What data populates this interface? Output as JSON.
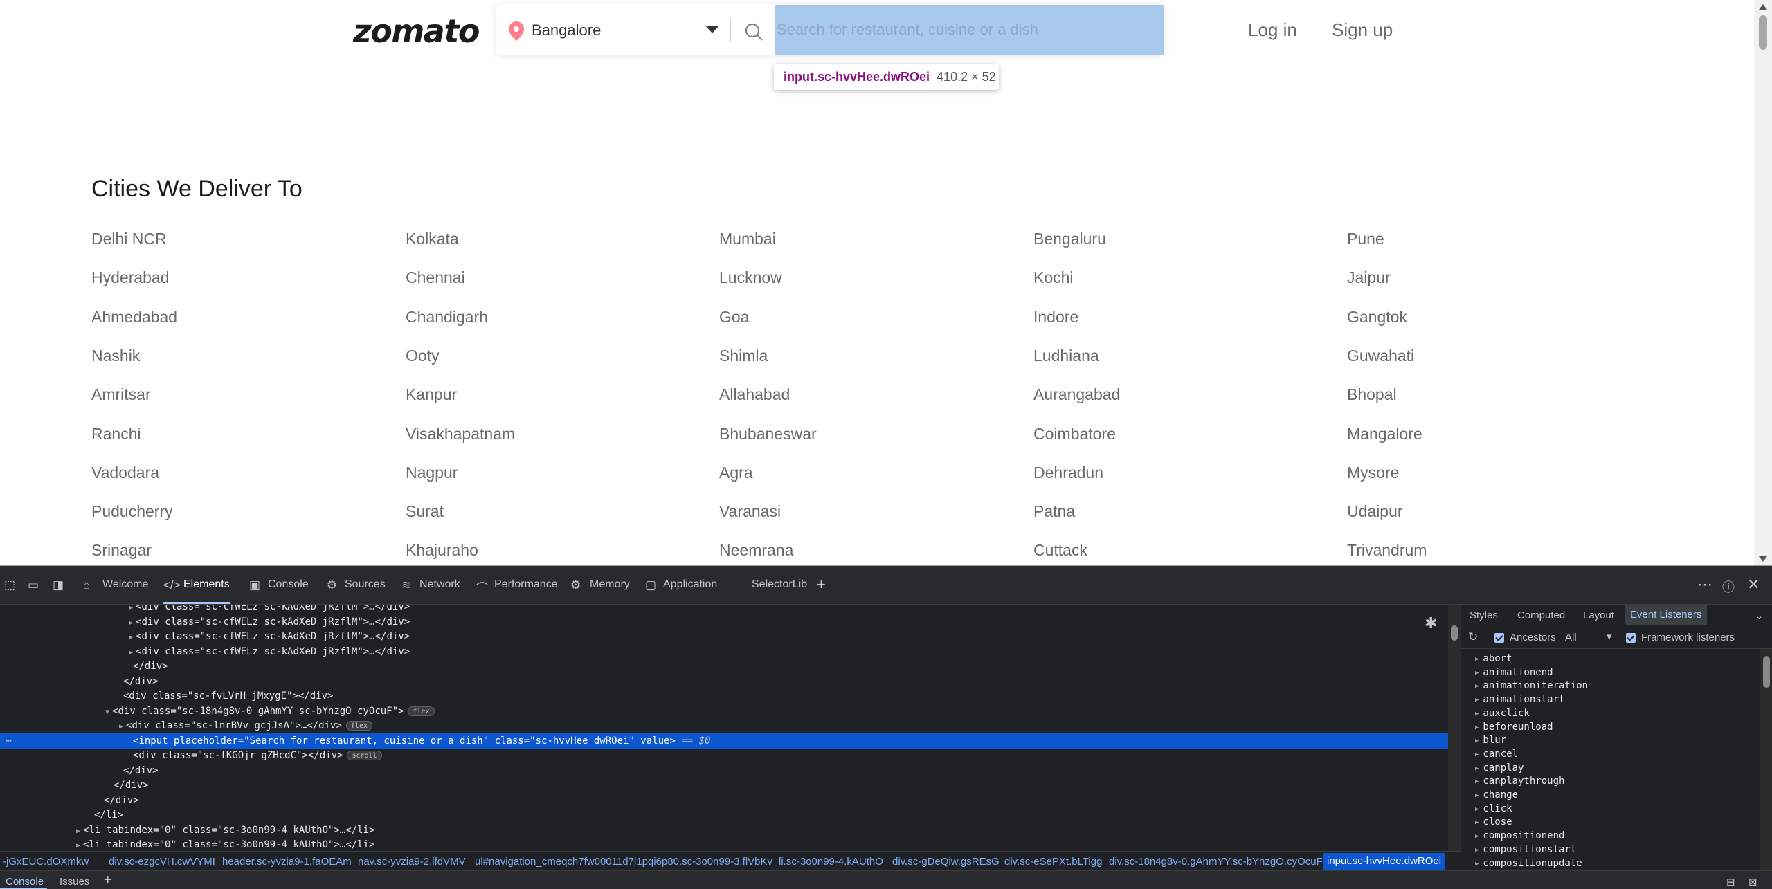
{
  "site": {
    "logo": "zomato",
    "location": "Bangalore",
    "search_placeholder": "Search for restaurant, cuisine or a dish",
    "login": "Log in",
    "signup": "Sign up",
    "inspect_tooltip": {
      "selector": "input.sc-hvvHee.dwROei",
      "size": "410.2 × 52"
    }
  },
  "cities_section": {
    "title": "Cities We Deliver To",
    "cities": [
      "Delhi NCR",
      "Kolkata",
      "Mumbai",
      "Bengaluru",
      "Pune",
      "Hyderabad",
      "Chennai",
      "Lucknow",
      "Kochi",
      "Jaipur",
      "Ahmedabad",
      "Chandigarh",
      "Goa",
      "Indore",
      "Gangtok",
      "Nashik",
      "Ooty",
      "Shimla",
      "Ludhiana",
      "Guwahati",
      "Amritsar",
      "Kanpur",
      "Allahabad",
      "Aurangabad",
      "Bhopal",
      "Ranchi",
      "Visakhapatnam",
      "Bhubaneswar",
      "Coimbatore",
      "Mangalore",
      "Vadodara",
      "Nagpur",
      "Agra",
      "Dehradun",
      "Mysore",
      "Puducherry",
      "Surat",
      "Varanasi",
      "Patna",
      "Udaipur",
      "Srinagar",
      "Khajuraho",
      "Neemrana",
      "Cuttack",
      "Trivandrum"
    ]
  },
  "devtools": {
    "tabs": [
      "Welcome",
      "Elements",
      "Console",
      "Sources",
      "Network",
      "Performance",
      "Memory",
      "Application",
      "SelectorLib"
    ],
    "active_tab": "Elements",
    "dom_lines": [
      {
        "text": "<div class=\"sc-cfWELz sc-kAdXeD jRzflM\">…</div>"
      },
      {
        "text": "<div class=\"sc-cfWELz sc-kAdXeD jRzflM\">…</div>"
      },
      {
        "text": "<div class=\"sc-cfWELz sc-kAdXeD jRzflM\">…</div>"
      },
      {
        "text": "<div class=\"sc-cfWELz sc-kAdXeD jRzflM\">…</div>"
      },
      {
        "text": "</div>"
      },
      {
        "text": "</div>"
      },
      {
        "text": "<div class=\"sc-fvLVrH jMxygE\"></div>"
      },
      {
        "text": "<div class=\"sc-18n4g8v-0 gAhmYY sc-bYnzgO cyOcuF\">",
        "badge": "flex"
      },
      {
        "text": "<div class=\"sc-lnrBVv gcjJsA\">…</div>",
        "badge": "flex"
      },
      {
        "text": "<input placeholder=\"Search for restaurant, cuisine or a dish\" class=\"sc-hvvHee dwROei\" value>",
        "suffix": "== $0"
      },
      {
        "text": "<div class=\"sc-fKGOjr gZHcdC\"></div>",
        "badge": "scroll"
      },
      {
        "text": "</div>"
      },
      {
        "text": "</div>"
      },
      {
        "text": "</div>"
      },
      {
        "text": "</li>"
      },
      {
        "text": "<li tabindex=\"0\" class=\"sc-3o0n99-4 kAUthO\">…</li>"
      },
      {
        "text": "<li tabindex=\"0\" class=\"sc-3o0n99-4 kAUthO\">…</li>"
      }
    ],
    "breadcrumbs": [
      "-jGxEUC.dOXmkw",
      "div.sc-ezgcVH.cwVYMI",
      "header.sc-yvzia9-1.faOEAm",
      "nav.sc-yvzia9-2.lfdVMV",
      "ul#navigation_cmeqch7fw00011d7l1pqi6p80.sc-3o0n99-3.flVbKv",
      "li.sc-3o0n99-4.kAUthO",
      "div.sc-gDeQiw.gsREsG",
      "div.sc-eSePXt.bLTigg",
      "div.sc-18n4g8v-0.gAhmYY.sc-bYnzgO.cyOcuF",
      "input.sc-hvvHee.dwROei"
    ],
    "side_tabs": [
      "Styles",
      "Computed",
      "Layout",
      "Event Listeners"
    ],
    "side_active": "Event Listeners",
    "ancestors_label": "Ancestors",
    "filter_value": "All",
    "framework_label": "Framework listeners",
    "events": [
      "abort",
      "animationend",
      "animationiteration",
      "animationstart",
      "auxclick",
      "beforeunload",
      "blur",
      "cancel",
      "canplay",
      "canplaythrough",
      "change",
      "click",
      "close",
      "compositionend",
      "compositionstart",
      "compositionupdate"
    ],
    "drawer_tabs": [
      "Console",
      "Issues"
    ]
  }
}
